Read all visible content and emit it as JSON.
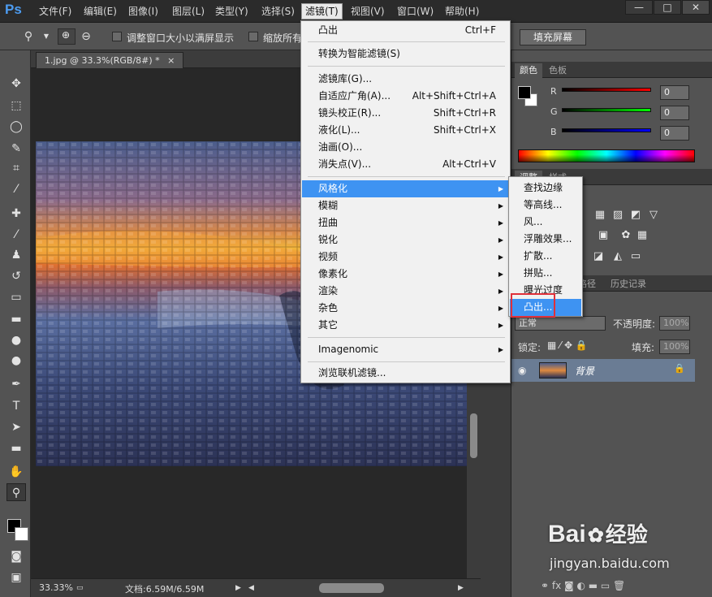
{
  "app": {
    "logo": "Ps"
  },
  "menubar": {
    "items": [
      "文件(F)",
      "编辑(E)",
      "图像(I)",
      "图层(L)",
      "类型(Y)",
      "选择(S)",
      "滤镜(T)",
      "视图(V)",
      "窗口(W)",
      "帮助(H)"
    ],
    "active_index": 6
  },
  "window_controls": {
    "minimize": "—",
    "maximize": "□",
    "close": "✕"
  },
  "options": {
    "fit_window_label": "调整窗口大小以满屏显示",
    "zoom_all_label": "缩放所有",
    "fill_screen_label": "填充屏幕"
  },
  "document": {
    "tab_title": "1.jpg @ 33.3%(RGB/8#) *",
    "close": "×",
    "zoom": "33.33%",
    "doc_size": "文档:6.59M/6.59M"
  },
  "filter_menu": {
    "items": [
      {
        "label": "凸出",
        "shortcut": "Ctrl+F"
      },
      {
        "label": "转换为智能滤镜(S)",
        "shortcut": ""
      },
      {
        "label": "滤镜库(G)...",
        "shortcut": ""
      },
      {
        "label": "自适应广角(A)...",
        "shortcut": "Alt+Shift+Ctrl+A"
      },
      {
        "label": "镜头校正(R)...",
        "shortcut": "Shift+Ctrl+R"
      },
      {
        "label": "液化(L)...",
        "shortcut": "Shift+Ctrl+X"
      },
      {
        "label": "油画(O)...",
        "shortcut": ""
      },
      {
        "label": "消失点(V)...",
        "shortcut": "Alt+Ctrl+V"
      },
      {
        "label": "风格化",
        "submenu": true,
        "highlighted": true
      },
      {
        "label": "模糊",
        "submenu": true
      },
      {
        "label": "扭曲",
        "submenu": true
      },
      {
        "label": "锐化",
        "submenu": true
      },
      {
        "label": "视频",
        "submenu": true
      },
      {
        "label": "像素化",
        "submenu": true
      },
      {
        "label": "渲染",
        "submenu": true
      },
      {
        "label": "杂色",
        "submenu": true
      },
      {
        "label": "其它",
        "submenu": true
      },
      {
        "label": "Imagenomic",
        "submenu": true
      },
      {
        "label": "浏览联机滤镜...",
        "shortcut": ""
      }
    ]
  },
  "stylize_menu": {
    "items": [
      "查找边缘",
      "等高线...",
      "风...",
      "浮雕效果...",
      "扩散...",
      "拼贴...",
      "曝光过度",
      "凸出..."
    ],
    "highlighted_index": 7
  },
  "color_panel": {
    "tabs": [
      "颜色",
      "色板"
    ],
    "r_label": "R",
    "g_label": "G",
    "b_label": "B",
    "r": "0",
    "g": "0",
    "b": "0"
  },
  "adjust_panel": {
    "tabs": [
      "调整",
      "样式"
    ]
  },
  "layers_panel": {
    "tabs": [
      "路径",
      "历史记录"
    ],
    "blend_mode": "正常",
    "opacity_label": "不透明度:",
    "opacity": "100%",
    "lock_label": "锁定:",
    "fill_label": "填充:",
    "fill": "100%",
    "layer_name": "背景"
  },
  "watermark": {
    "brand": "Bai",
    "brand2": "经验",
    "url": "jingyan.baidu.com"
  }
}
